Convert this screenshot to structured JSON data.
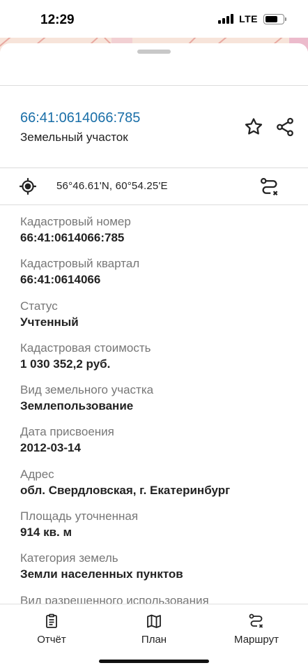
{
  "status_bar": {
    "time": "12:29",
    "network": "LTE",
    "battery_level": 0.72
  },
  "header": {
    "cadastral_link": "66:41:0614066:785",
    "object_type": "Земельный участок",
    "icons": [
      "star-icon",
      "share-icon"
    ]
  },
  "location": {
    "coordinates": "56°46.61'N, 60°54.25'E",
    "icons": [
      "location-target-icon",
      "route-icon"
    ]
  },
  "fields": [
    {
      "label": "Кадастровый номер",
      "value": "66:41:0614066:785"
    },
    {
      "label": "Кадастровый квартал",
      "value": "66:41:0614066"
    },
    {
      "label": "Статус",
      "value": "Учтенный"
    },
    {
      "label": "Кадастровая стоимость",
      "value": "1 030 352,2 руб."
    },
    {
      "label": "Вид земельного участка",
      "value": "Землепользование"
    },
    {
      "label": "Дата присвоения",
      "value": "2012-03-14"
    },
    {
      "label": "Адрес",
      "value": "обл. Свердловская, г. Екатеринбург"
    },
    {
      "label": "Площадь уточненная",
      "value": "914 кв. м"
    },
    {
      "label": "Категория земель",
      "value": "Земли населенных пунктов"
    },
    {
      "label": "Вид разрешенного использования",
      "value": ""
    }
  ],
  "bottom_nav": {
    "report": "Отчёт",
    "plan": "План",
    "route": "Маршрут"
  },
  "colors": {
    "link": "#1a6fa8",
    "label": "#777777",
    "value": "#222222",
    "map_background": "#f7e4da"
  }
}
